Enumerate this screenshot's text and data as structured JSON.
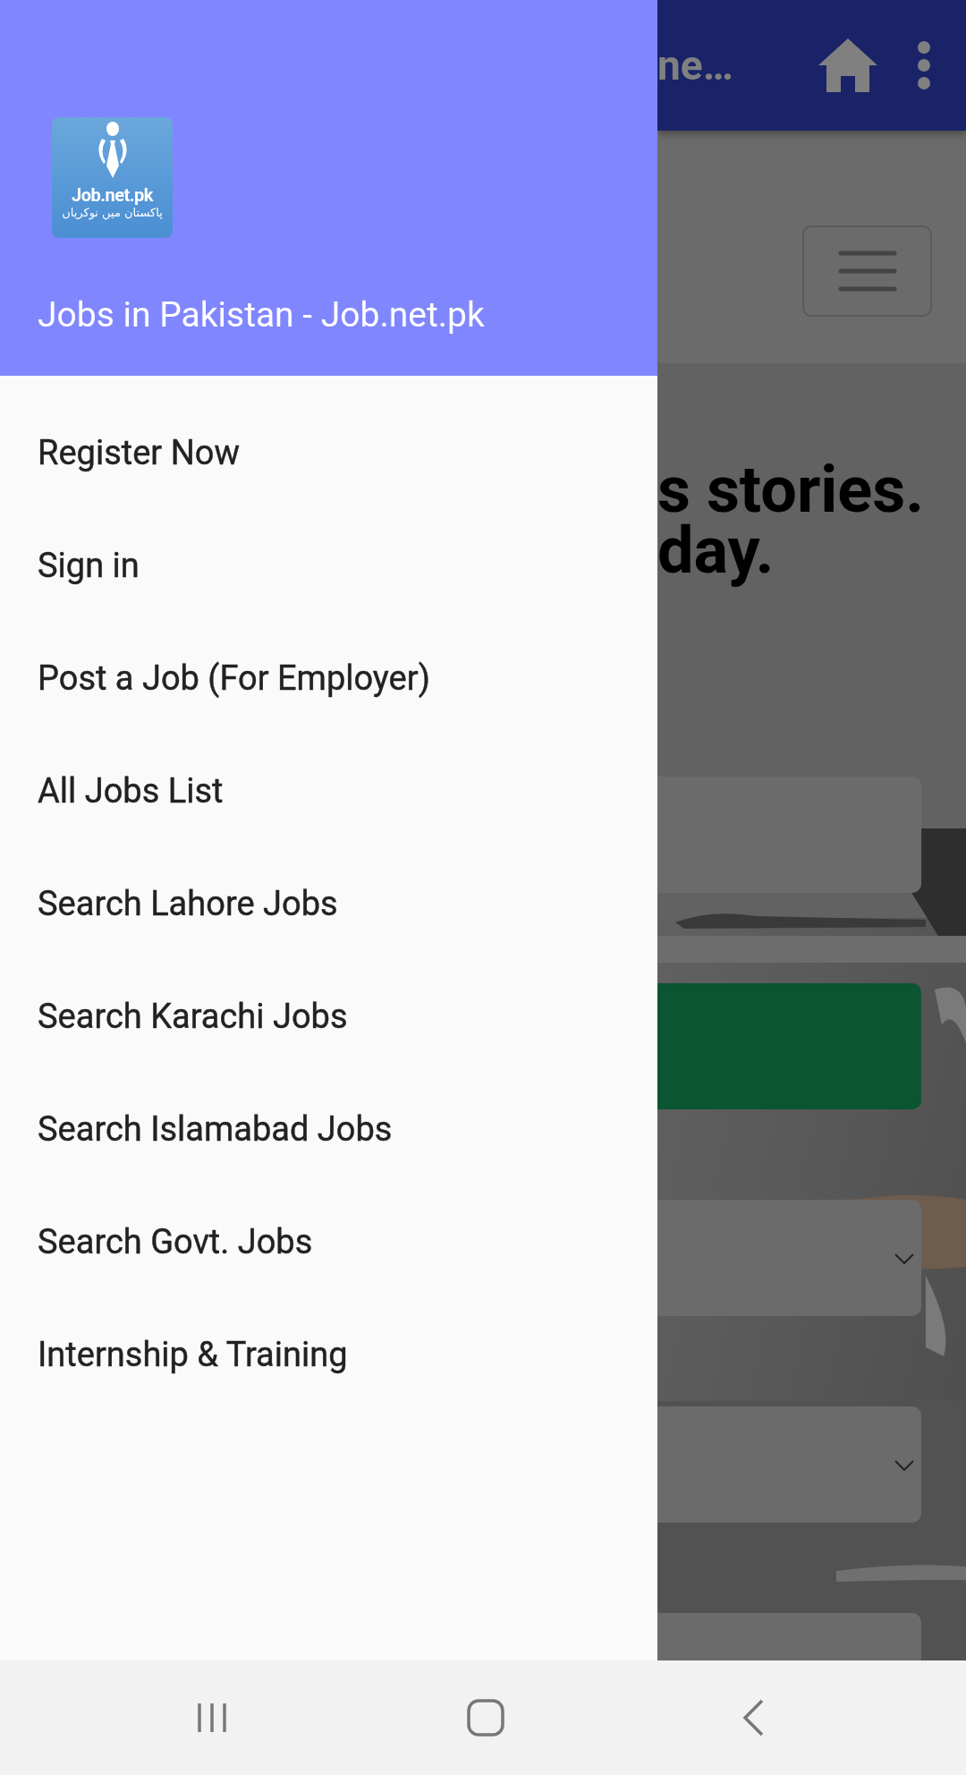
{
  "drawer": {
    "logo": {
      "name": "Job.net.pk",
      "tagline": "پاکستان میں نوکریاں"
    },
    "title": "Jobs in Pakistan - Job.net.pk",
    "items": [
      {
        "label": "Register Now"
      },
      {
        "label": "Sign in"
      },
      {
        "label": "Post a Job (For Employer)"
      },
      {
        "label": "All Jobs List"
      },
      {
        "label": "Search Lahore Jobs"
      },
      {
        "label": "Search Karachi Jobs"
      },
      {
        "label": "Search Islamabad Jobs"
      },
      {
        "label": "Search Govt. Jobs"
      },
      {
        "label": "Internship & Training"
      }
    ]
  },
  "background_page": {
    "app_bar": {
      "title": "ne…"
    },
    "hero": {
      "kind": "picture",
      "heading_lines": [
        "s stories.",
        "day."
      ]
    },
    "form": [
      {
        "kind": "input"
      },
      {
        "kind": "button"
      },
      {
        "kind": "select"
      },
      {
        "kind": "select"
      },
      {
        "kind": "input"
      }
    ]
  }
}
